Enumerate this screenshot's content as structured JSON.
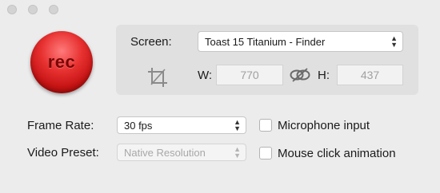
{
  "rec_button": {
    "label": "rec",
    "color": "#d61f1f"
  },
  "screen": {
    "label": "Screen:",
    "selected": "Toast 15 Titanium - Finder"
  },
  "crop": {
    "icon": "crop-icon"
  },
  "width": {
    "label": "W:",
    "value": "770"
  },
  "link": {
    "icon": "link-icon"
  },
  "height": {
    "label": "H:",
    "value": "437"
  },
  "frame_rate": {
    "label": "Frame Rate:",
    "selected": "30 fps"
  },
  "video_preset": {
    "label": "Video Preset:",
    "selected": "Native Resolution"
  },
  "microphone": {
    "label": "Microphone input",
    "checked": false
  },
  "mouse_click": {
    "label": "Mouse click animation",
    "checked": false
  }
}
